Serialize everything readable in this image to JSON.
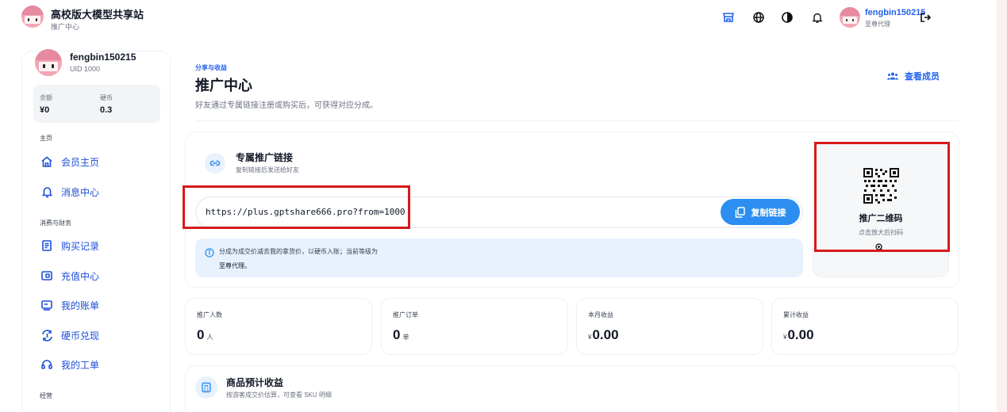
{
  "brand": {
    "title": "高校版大模型共享站",
    "subtitle": "推广中心"
  },
  "header_user": {
    "name": "fengbin150215",
    "level": "至尊代理"
  },
  "sidebar": {
    "username": "fengbin150215",
    "uid": "UID 1000",
    "balance": {
      "label": "余额",
      "value": "¥0"
    },
    "coins": {
      "label": "硬币",
      "value": "0.3"
    },
    "sections": [
      {
        "title": "主页",
        "items": [
          {
            "label": "会员主页",
            "icon": "home-icon"
          },
          {
            "label": "消息中心",
            "icon": "bell-icon"
          }
        ]
      },
      {
        "title": "消费与财务",
        "items": [
          {
            "label": "购买记录",
            "icon": "receipt-icon"
          },
          {
            "label": "充值中心",
            "icon": "wallet-icon"
          },
          {
            "label": "我的账单",
            "icon": "bill-icon"
          },
          {
            "label": "硬币兑现",
            "icon": "exchange-icon"
          },
          {
            "label": "我的工单",
            "icon": "headset-icon"
          }
        ]
      },
      {
        "title": "经营",
        "items": []
      }
    ]
  },
  "main": {
    "eyebrow": "分享与收益",
    "title": "推广中心",
    "description": "好友通过专属链接注册或购买后，可获得对应分成。",
    "members_button": "查看成员",
    "promo": {
      "title": "专属推广链接",
      "subtitle": "复制链接后发送给好友",
      "url": "https://plus.gptshare666.pro?from=1000",
      "copy_button": "复制链接",
      "info_line1": "分成为成交价减去我的拿货价，以硬币入账；当前等级为",
      "info_line2": "至尊代理。",
      "qr_title": "推广二维码",
      "qr_hint": "点击放大后扫码"
    },
    "stats": [
      {
        "label": "推广人数",
        "value": "0",
        "unit": "人",
        "currency": ""
      },
      {
        "label": "推广订单",
        "value": "0",
        "unit": "单",
        "currency": ""
      },
      {
        "label": "本月收益",
        "value": "0.00",
        "unit": "",
        "currency": "¥"
      },
      {
        "label": "累计收益",
        "value": "0.00",
        "unit": "",
        "currency": "¥"
      }
    ],
    "goods": {
      "title": "商品预计收益",
      "subtitle": "按游客成交价估算，可查看 SKU 明细"
    }
  },
  "colors": {
    "accent": "#2b8ef0",
    "link": "#2563eb",
    "highlight": "#d7191c",
    "info_bg": "#e7f2fd"
  }
}
